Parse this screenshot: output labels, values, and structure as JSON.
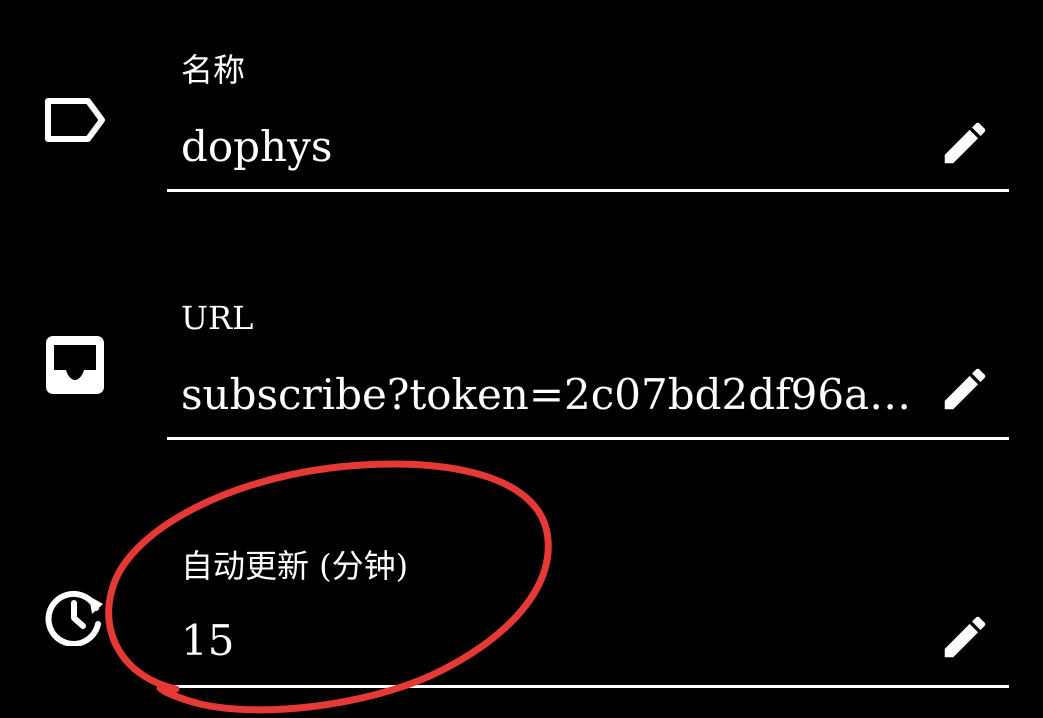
{
  "fields": [
    {
      "label": "名称",
      "value": "dophys",
      "icon": "label-tag-icon",
      "edit_icon": "pencil-edit-icon"
    },
    {
      "label": "URL",
      "value": "subscribe?token=2c07bd2df96a5…",
      "icon": "inbox-tray-icon",
      "edit_icon": "pencil-edit-icon"
    },
    {
      "label": "自动更新 (分钟)",
      "value": "15",
      "icon": "clock-refresh-icon",
      "edit_icon": "pencil-edit-icon"
    }
  ],
  "annotation": {
    "shape": "hand-drawn circle",
    "color": "#e53935",
    "target": "auto-update field"
  },
  "colors": {
    "background": "#000000",
    "text": "#ffffff",
    "divider": "#ffffff"
  }
}
